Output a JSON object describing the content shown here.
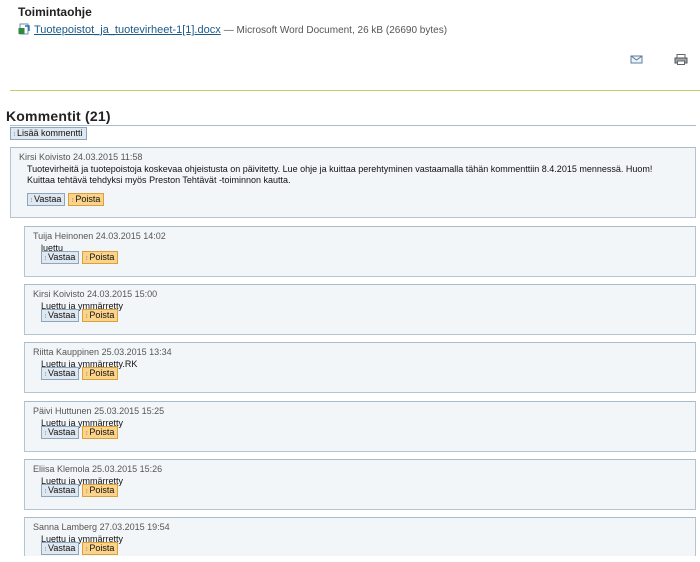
{
  "section": {
    "title": "Toimintaohje"
  },
  "attachment": {
    "icon": "word-document-icon",
    "filename": "Tuotepoistot_ja_tuotevirheet-1[1].docx",
    "meta": "— Microsoft Word Document, 26 kB (26690 bytes)"
  },
  "tools": {
    "email_icon": "email-icon",
    "print_icon": "print-icon"
  },
  "comments": {
    "title": "Kommentit (21)",
    "add_label": "Lisää kommentti",
    "reply_label": "Vastaa",
    "delete_label": "Poista",
    "items": [
      {
        "author": "Kirsi Koivisto",
        "date": "24.03.2015 11:58",
        "text": "Tuotevirheitä ja tuotepoistoja koskevaa ohjeistusta on päivitetty. Lue ohje ja kuittaa perehtyminen vastaamalla tähän kommenttiin 8.4.2015 mennessä. Huom! Kuittaa tehtävä tehdyksi myös Preston Tehtävät -toiminnon kautta."
      },
      {
        "author": "Tuija Heinonen",
        "date": "24.03.2015 14:02",
        "text": "luettu"
      },
      {
        "author": "Kirsi Koivisto",
        "date": "24.03.2015 15:00",
        "text": "Luettu ja ymmärretty"
      },
      {
        "author": "Riitta Kauppinen",
        "date": "25.03.2015 13:34",
        "text": "Luettu ja ymmärretty.RK"
      },
      {
        "author": "Päivi Huttunen",
        "date": "25.03.2015 15:25",
        "text": "Luettu ja ymmärretty"
      },
      {
        "author": "Eliisa Klemola",
        "date": "25.03.2015 15:26",
        "text": "Luettu ja ymmärretty"
      },
      {
        "author": "Sanna Lamberg",
        "date": "27.03.2015 19:54",
        "text": "Luettu ja ymmärretty"
      }
    ]
  },
  "colors": {
    "accent_rule": "#b9d26c",
    "link": "#1a5a8a",
    "delete_button": "#fbd38a",
    "reply_button": "#dfe8f1"
  }
}
